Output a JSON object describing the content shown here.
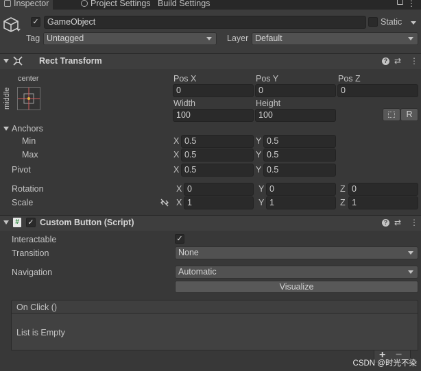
{
  "tabs": [
    {
      "label": "Inspector"
    },
    {
      "label": "Project Settings"
    },
    {
      "label": "Build Settings"
    }
  ],
  "header": {
    "object_name": "GameObject",
    "active": true,
    "static_label": "Static",
    "tag_label": "Tag",
    "tag_value": "Untagged",
    "layer_label": "Layer",
    "layer_value": "Default"
  },
  "rect_transform": {
    "title": "Rect Transform",
    "anchor_preset_h": "center",
    "anchor_preset_v": "middle",
    "pos_x_label": "Pos X",
    "pos_x": "0",
    "pos_y_label": "Pos Y",
    "pos_y": "0",
    "pos_z_label": "Pos Z",
    "pos_z": "0",
    "width_label": "Width",
    "width": "100",
    "height_label": "Height",
    "height": "100",
    "raw_button": "R",
    "anchors_label": "Anchors",
    "min_label": "Min",
    "min_x": "0.5",
    "min_y": "0.5",
    "max_label": "Max",
    "max_x": "0.5",
    "max_y": "0.5",
    "pivot_label": "Pivot",
    "pivot_x": "0.5",
    "pivot_y": "0.5",
    "rotation_label": "Rotation",
    "rot_x": "0",
    "rot_y": "0",
    "rot_z": "0",
    "scale_label": "Scale",
    "scale_x": "1",
    "scale_y": "1",
    "scale_z": "1",
    "x": "X",
    "y": "Y",
    "z": "Z"
  },
  "custom_button": {
    "title": "Custom Button (Script)",
    "enabled": true,
    "interactable_label": "Interactable",
    "interactable": true,
    "transition_label": "Transition",
    "transition_value": "None",
    "navigation_label": "Navigation",
    "navigation_value": "Automatic",
    "visualize_label": "Visualize",
    "onclick_label": "On Click ()",
    "list_empty": "List is Empty",
    "add": "+",
    "remove": "−"
  },
  "watermark": "CSDN @时光不染"
}
